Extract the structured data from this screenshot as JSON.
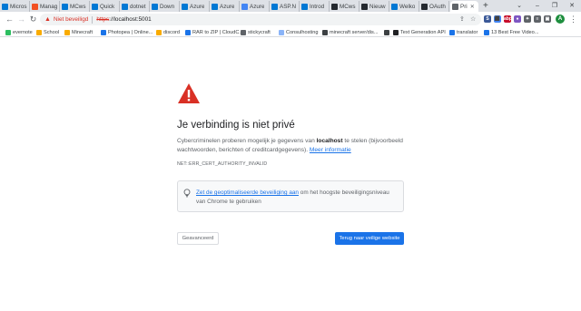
{
  "tabs": [
    {
      "label": "Micros",
      "color": "#0078d4"
    },
    {
      "label": "Manag",
      "color": "#f25022"
    },
    {
      "label": "MCws",
      "color": "#0078d4"
    },
    {
      "label": "Quick",
      "color": "#0078d4"
    },
    {
      "label": "dotnet",
      "color": "#0078d4"
    },
    {
      "label": "Down",
      "color": "#0078d4"
    },
    {
      "label": "Azure",
      "color": "#0078d4"
    },
    {
      "label": "Azure",
      "color": "#0078d4"
    },
    {
      "label": "Azure",
      "color": "#4285f4"
    },
    {
      "label": "ASP.N",
      "color": "#0078d4"
    },
    {
      "label": "Introd",
      "color": "#0078d4"
    },
    {
      "label": "MCws",
      "color": "#24292f"
    },
    {
      "label": "Nieuw",
      "color": "#24292f"
    },
    {
      "label": "Welko",
      "color": "#0078d4"
    },
    {
      "label": "OAuth",
      "color": "#24292f"
    }
  ],
  "active_tab": {
    "label": "Pri"
  },
  "new_tab_glyph": "+",
  "window_controls": {
    "search_tabs": "⌄",
    "minimize": "–",
    "restore": "❐",
    "close": "✕"
  },
  "nav": {
    "back": "←",
    "forward": "→",
    "reload": "↻"
  },
  "omnibox": {
    "security_label": "Niet beveiligd",
    "scheme": "https",
    "rest": "://localhost:5001"
  },
  "toolbar_right": {
    "share": "⇪",
    "star": "☆"
  },
  "extensions": [
    {
      "text": "S",
      "color": "#3b5998"
    },
    {
      "text": "⬛",
      "color": "#4285f4"
    },
    {
      "text": "abp",
      "color": "#c70d2c"
    },
    {
      "text": "●",
      "color": "#7e57c2"
    },
    {
      "text": "✦",
      "color": "#5f6368"
    },
    {
      "text": "≡",
      "color": "#5f6368"
    },
    {
      "text": "▣",
      "color": "#5f6368"
    }
  ],
  "profile_initial": "A",
  "menu_glyph": "⋮",
  "bookmarks": [
    {
      "label": "evernote",
      "color": "#2dbe60"
    },
    {
      "label": "School",
      "color": "#f9ab00"
    },
    {
      "label": "Minecraft",
      "color": "#f9ab00"
    },
    {
      "label": "Photopea | Online...",
      "color": "#1a73e8"
    },
    {
      "label": "discord",
      "color": "#f9ab00"
    },
    {
      "label": "RAR to ZIP | CloudC...",
      "color": "#1a73e8"
    },
    {
      "label": "stickycraft",
      "color": "#5f6368"
    },
    {
      "label": "Consulhosting",
      "color": "#8ab4f8"
    },
    {
      "label": "minecraft server/dis...",
      "color": "#3c4043"
    },
    {
      "label": "",
      "color": "#3c4043"
    },
    {
      "label": "Text Generation API",
      "color": "#202124"
    },
    {
      "label": "translator",
      "color": "#1a73e8"
    },
    {
      "label": "13 Best Free Video...",
      "color": "#1a73e8"
    }
  ],
  "page": {
    "title": "Je verbinding is niet privé",
    "para_part1": "Cybercriminelen proberen mogelijk je gegevens van ",
    "para_host": "localhost",
    "para_part2": " te stelen (bijvoorbeeld wachtwoorden, berichten of creditcardgegevens). ",
    "more_info": "Meer informatie",
    "error_code": "NET::ERR_CERT_AUTHORITY_INVALID",
    "tip_link": "Zet de geoptimaliseerde beveiliging aan",
    "tip_rest": " om het hoogste beveiligingsniveau van Chrome te gebruiken",
    "advanced_button": "Geavanceerd",
    "back_button": "Terug naar veilige website"
  },
  "colors": {
    "warning_red": "#d93025",
    "link_blue": "#1a73e8"
  }
}
